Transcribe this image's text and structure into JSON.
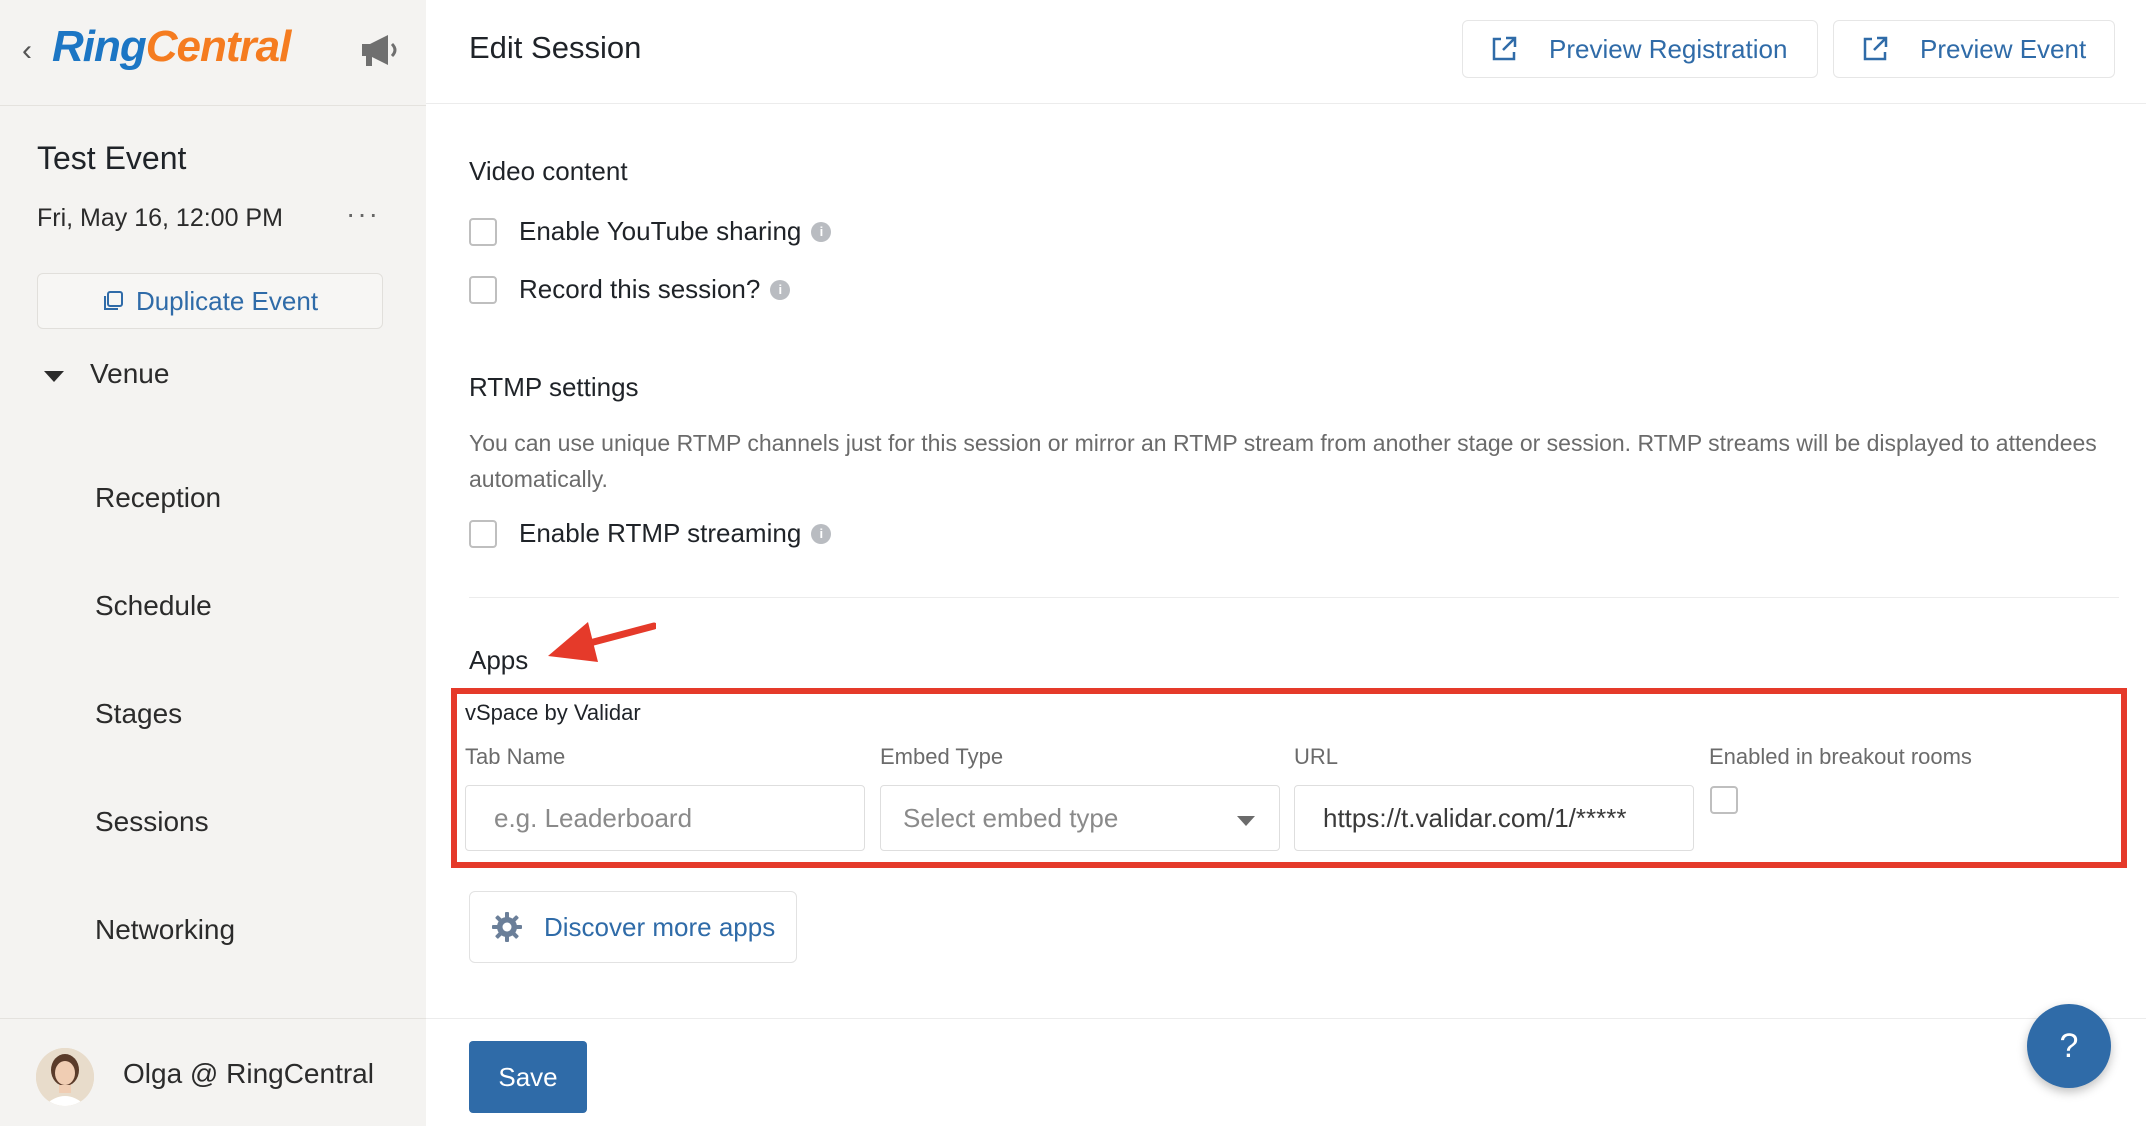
{
  "sidebar": {
    "brand_ring": "Ring",
    "brand_central": "Central",
    "event_title": "Test Event",
    "event_date": "Fri, May 16, 12:00 PM",
    "more_label": "···",
    "duplicate_label": "Duplicate Event",
    "venue_label": "Venue",
    "nav": [
      "Reception",
      "Schedule",
      "Stages",
      "Sessions",
      "Networking"
    ],
    "user_name": "Olga @ RingCentral"
  },
  "header": {
    "title": "Edit Session",
    "preview_registration": "Preview Registration",
    "preview_event": "Preview Event"
  },
  "video": {
    "title": "Video content",
    "youtube_label": "Enable YouTube sharing",
    "record_label": "Record this session?"
  },
  "rtmp": {
    "title": "RTMP settings",
    "description": "You can use unique RTMP channels just for this session or mirror an RTMP stream from another stage or session. RTMP streams will be displayed to attendees automatically.",
    "enable_label": "Enable RTMP streaming"
  },
  "apps": {
    "title": "Apps",
    "app_name": "vSpace by Validar",
    "tab_name_label": "Tab Name",
    "tab_name_placeholder": "e.g. Leaderboard",
    "embed_type_label": "Embed Type",
    "embed_type_value": "Select embed type",
    "url_label": "URL",
    "url_value": "https://t.validar.com/1/*****",
    "breakout_label": "Enabled in breakout rooms",
    "discover_label": "Discover more apps"
  },
  "footer": {
    "save_label": "Save",
    "help_label": "?"
  },
  "colors": {
    "accent": "#2f6ba8",
    "highlight_red": "#e53a2a",
    "brand_blue": "#1c76c4",
    "brand_orange": "#f57c20"
  },
  "icons": [
    "chevron-left-icon",
    "megaphone-icon",
    "more-icon",
    "duplicate-icon",
    "caret-down-icon",
    "external-link-icon",
    "info-icon",
    "arrow-icon",
    "gear-icon",
    "help-icon"
  ]
}
